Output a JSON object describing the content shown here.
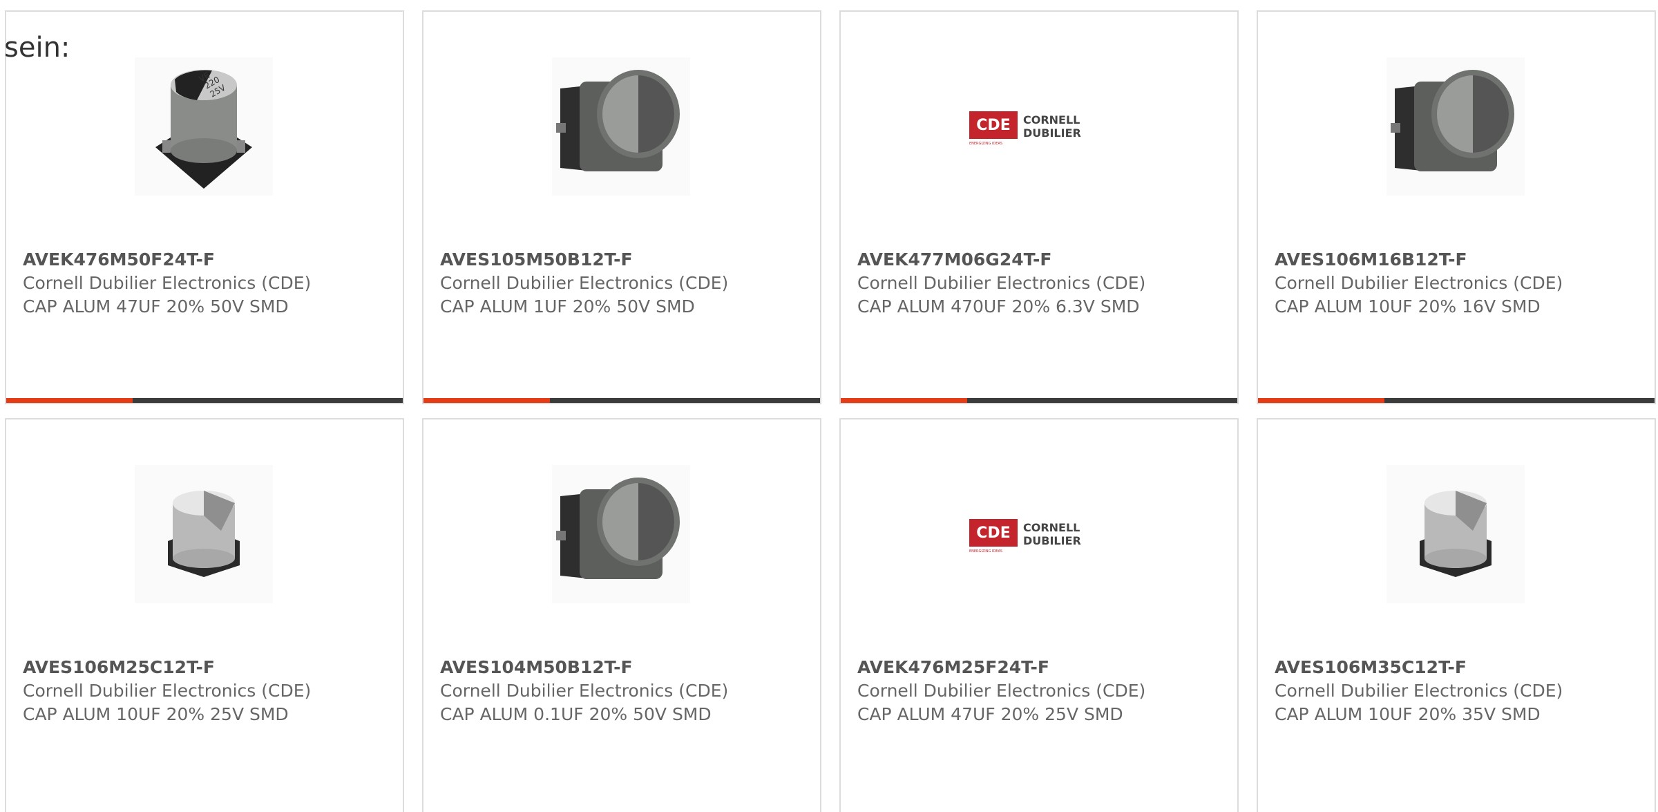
{
  "intro_text": "sein:",
  "products": [
    {
      "part_number": "AVEK476M50F24T-F",
      "manufacturer": "Cornell Dubilier Electronics (CDE)",
      "description": "CAP ALUM 47UF 20% 50V SMD",
      "image": "cap-black-top-icon"
    },
    {
      "part_number": "AVES105M50B12T-F",
      "manufacturer": "Cornell Dubilier Electronics (CDE)",
      "description": "CAP ALUM 1UF 20% 50V SMD",
      "image": "cap-side-icon"
    },
    {
      "part_number": "AVEK477M06G24T-F",
      "manufacturer": "Cornell Dubilier Electronics (CDE)",
      "description": "CAP ALUM 470UF 20% 6.3V SMD",
      "image": "cde-logo"
    },
    {
      "part_number": "AVES106M16B12T-F",
      "manufacturer": "Cornell Dubilier Electronics (CDE)",
      "description": "CAP ALUM 10UF 20% 16V SMD",
      "image": "cap-side-icon"
    },
    {
      "part_number": "AVES106M25C12T-F",
      "manufacturer": "Cornell Dubilier Electronics (CDE)",
      "description": "CAP ALUM 10UF 20% 25V SMD",
      "image": "cap-silver-icon"
    },
    {
      "part_number": "AVES104M50B12T-F",
      "manufacturer": "Cornell Dubilier Electronics (CDE)",
      "description": "CAP ALUM 0.1UF 20% 50V SMD",
      "image": "cap-side-icon"
    },
    {
      "part_number": "AVEK476M25F24T-F",
      "manufacturer": "Cornell Dubilier Electronics (CDE)",
      "description": "CAP ALUM 47UF 20% 25V SMD",
      "image": "cde-logo"
    },
    {
      "part_number": "AVES106M35C12T-F",
      "manufacturer": "Cornell Dubilier Electronics (CDE)",
      "description": "CAP ALUM 10UF 20% 35V SMD",
      "image": "cap-silver-icon"
    }
  ],
  "cde_logo": {
    "badge": "CDE",
    "line1": "CORNELL",
    "line2": "DUBILIER",
    "tagline": "ENERGIZING IDEAS"
  },
  "black_cap_marking": {
    "line1": "VE",
    "line2": "220",
    "line3": "25V"
  },
  "colors": {
    "accent": "#e63c16",
    "bar_dark": "#3b3b3b",
    "border": "#dcdcdc",
    "logo_red": "#c4242b"
  }
}
